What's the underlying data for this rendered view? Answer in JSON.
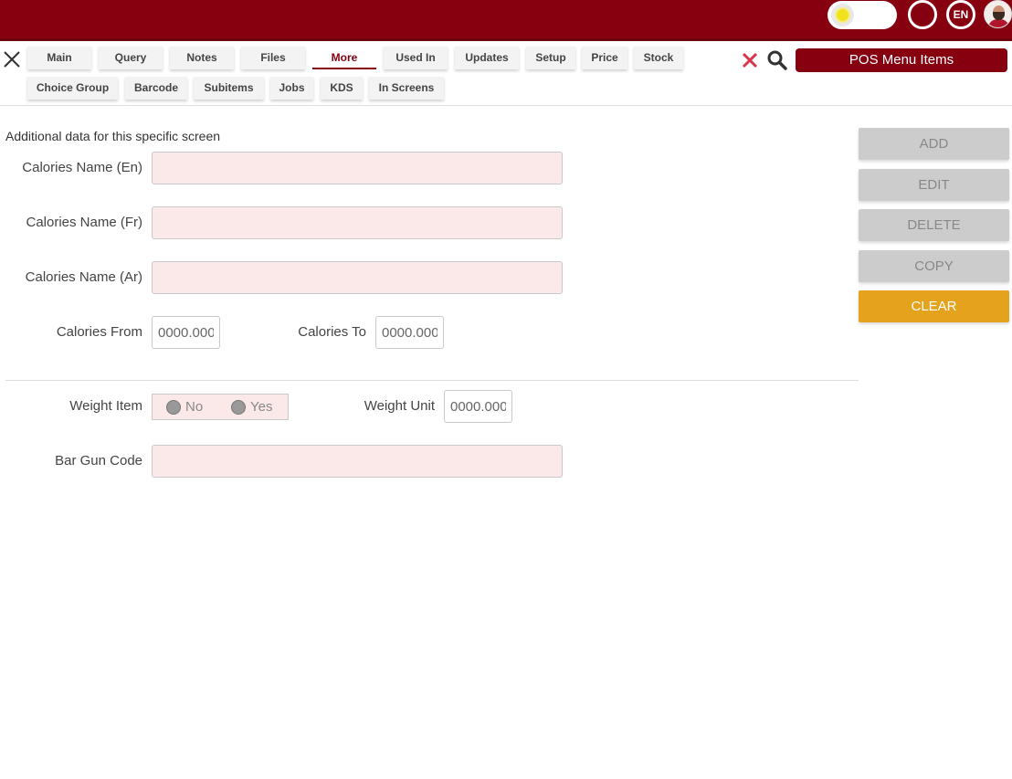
{
  "header": {
    "language": "EN",
    "theme_toggle_icon": "sun-icon",
    "colors": {
      "brand": "#870010",
      "accent": "#e5a21d"
    }
  },
  "tabs_row1": [
    "Main",
    "Query",
    "Notes",
    "Files",
    "More",
    "Used In",
    "Updates",
    "Setup",
    "Price",
    "Stock"
  ],
  "tabs_row2": [
    "Choice Group",
    "Barcode",
    "Subitems",
    "Jobs",
    "KDS",
    "In Screens"
  ],
  "active_tab": "More",
  "screen_title": "POS Menu Items",
  "form": {
    "section_note": "Additional data for this specific screen",
    "calories_name_en": {
      "label": "Calories Name (En)",
      "value": ""
    },
    "calories_name_fr": {
      "label": "Calories Name (Fr)",
      "value": ""
    },
    "calories_name_ar": {
      "label": "Calories Name (Ar)",
      "value": ""
    },
    "calories_from": {
      "label": "Calories From",
      "placeholder": "0000.000"
    },
    "calories_to": {
      "label": "Calories To",
      "placeholder": "0000.000"
    },
    "weight_item": {
      "label": "Weight Item",
      "options": [
        "No",
        "Yes"
      ]
    },
    "weight_unit": {
      "label": "Weight Unit",
      "placeholder": "0000.000"
    },
    "bar_gun_code": {
      "label": "Bar Gun Code",
      "value": ""
    }
  },
  "actions": {
    "add": "ADD",
    "edit": "EDIT",
    "delete": "DELETE",
    "copy": "COPY",
    "clear": "CLEAR"
  }
}
